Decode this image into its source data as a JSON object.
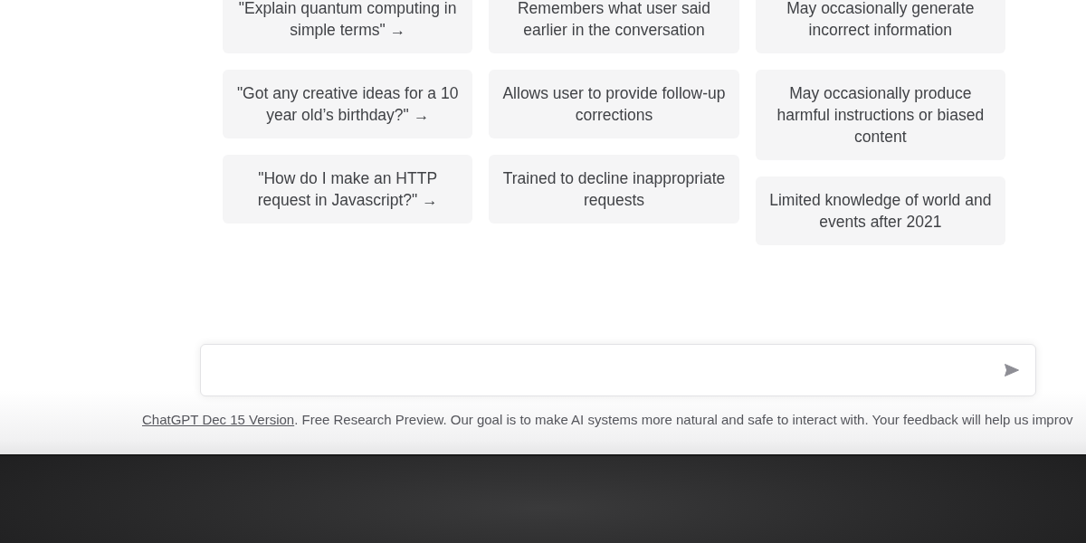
{
  "columns": [
    {
      "items": [
        "\"Explain quantum computing in simple terms\" →",
        "\"Got any creative ideas for a 10 year old’s birthday?\" →",
        "\"How do I make an HTTP request in Javascript?\" →"
      ]
    },
    {
      "items": [
        "Remembers what user said earlier in the conversation",
        "Allows user to provide follow-up corrections",
        "Trained to decline inappropriate requests"
      ]
    },
    {
      "items": [
        "May occasionally generate incorrect information",
        "May occasionally produce harmful instructions or biased content",
        "Limited knowledge of world and events after 2021"
      ]
    }
  ],
  "footer": {
    "link": "ChatGPT Dec 15 Version",
    "text": ". Free Research Preview. Our goal is to make AI systems more natural and safe to interact with. Your feedback will help us improv"
  }
}
